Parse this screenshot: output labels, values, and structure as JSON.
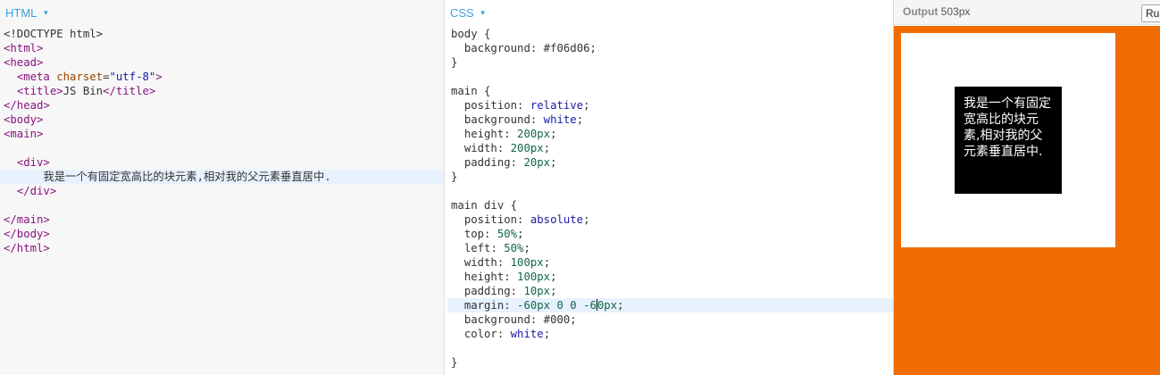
{
  "html_panel": {
    "title": "HTML"
  },
  "css_panel": {
    "title": "CSS"
  },
  "output_panel": {
    "label": "Output",
    "size": "503px",
    "run_label": "Run"
  },
  "html_code": {
    "doctype": "<!DOCTYPE html>",
    "html_open": "<html>",
    "head_open": "<head>",
    "meta_open": "<meta ",
    "meta_attr": "charset",
    "meta_eq": "=",
    "meta_val": "\"utf-8\"",
    "meta_close": ">",
    "title_open": "<title>",
    "title_text": "JS Bin",
    "title_close": "</title>",
    "head_close": "</head>",
    "body_open": "<body>",
    "main_open": "<main>",
    "div_open": "<div>",
    "div_text": "我是一个有固定宽高比的块元素,相对我的父元素垂直居中.",
    "div_close": "</div>",
    "main_close": "</main>",
    "body_close": "</body>",
    "html_close": "</html>"
  },
  "css_code": {
    "r1_sel": "body {",
    "r1_p1": "background",
    "r1_v1": "#f06d06",
    "r1_end": "}",
    "r2_sel": "main {",
    "r2_p1": "position",
    "r2_v1": "relative",
    "r2_p2": "background",
    "r2_v2": "white",
    "r2_p3": "height",
    "r2_v3": "200px",
    "r2_p4": "width",
    "r2_v4": "200px",
    "r2_p5": "padding",
    "r2_v5": "20px",
    "r2_end": "}",
    "r3_sel": "main div {",
    "r3_p1": "position",
    "r3_v1": "absolute",
    "r3_p2": "top",
    "r3_v2": "50%",
    "r3_p3": "left",
    "r3_v3": "50%",
    "r3_p4": "width",
    "r3_v4": "100px",
    "r3_p5": "height",
    "r3_v5": "100px",
    "r3_p6": "padding",
    "r3_v6": "10px",
    "r3_p7": "margin",
    "r3_v7a": "-60px 0 0 -6",
    "r3_v7b": "0px",
    "r3_p8": "background",
    "r3_v8": "#000",
    "r3_p9": "color",
    "r3_v9": "white",
    "r3_end": "}"
  },
  "preview": {
    "text": "我是一个有固定宽高比的块元素,相对我的父元素垂直居中."
  },
  "colors": {
    "accent": "#39a1dd",
    "output_bg": "#f06d06"
  }
}
